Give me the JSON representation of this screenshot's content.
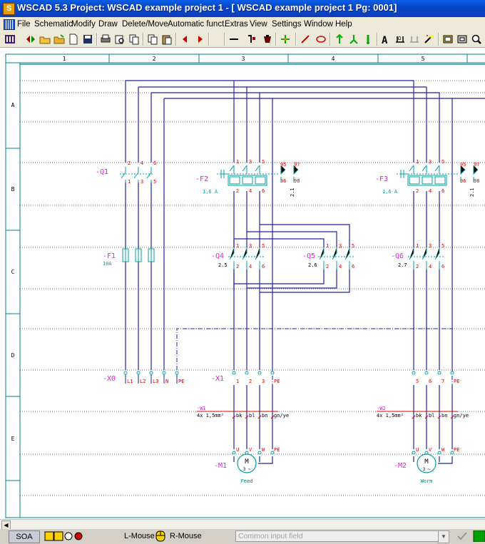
{
  "window": {
    "title": "WSCAD 5.3   Project: WSCAD example project 1 - [ WSCAD example project 1  Pg: 0001]",
    "app_icon": "S"
  },
  "menu": [
    "File",
    "Schematic",
    "Modify",
    "Draw",
    "Delete/Move",
    "Automatic funct.",
    "Extras",
    "View",
    "Settings",
    "Window",
    "Help"
  ],
  "sheet": {
    "columns": [
      "1",
      "2",
      "3",
      "4",
      "5"
    ],
    "rows": [
      "A",
      "B",
      "C",
      "D",
      "E"
    ]
  },
  "schematic": {
    "q1": {
      "ref": "-Q1",
      "pins_top": [
        "2",
        "4",
        "6"
      ],
      "pins_bottom": [
        "1",
        "3",
        "5"
      ]
    },
    "f1": {
      "ref": "-F1",
      "rating": "10A"
    },
    "x0": {
      "ref": "-X0",
      "terminals": [
        "L1",
        "L2",
        "L3",
        "N",
        "PE"
      ]
    },
    "f2": {
      "ref": "-F2",
      "rating": "1,6 A",
      "pins_top": [
        "1",
        "3",
        "5"
      ],
      "pins_bottom": [
        "2",
        "4",
        "6"
      ],
      "aux_top": [
        "95",
        "97"
      ],
      "aux_bottom": [
        "96",
        "98"
      ],
      "xref": "2.1"
    },
    "f3": {
      "ref": "-F3",
      "rating": "1,6 A",
      "pins_top": [
        "1",
        "3",
        "5"
      ],
      "pins_bottom": [
        "2",
        "4",
        "6"
      ],
      "aux_top": [
        "95",
        "97"
      ],
      "aux_bottom": [
        "96",
        "98"
      ],
      "xref": "2.1"
    },
    "q4": {
      "ref": "-Q4",
      "xref": "2.5",
      "pins_top": [
        "1",
        "3",
        "5"
      ],
      "pins_bottom": [
        "2",
        "4",
        "6"
      ]
    },
    "q5": {
      "ref": "-Q5",
      "xref": "2.6",
      "pins_top": [
        "1",
        "3",
        "5"
      ],
      "pins_bottom": [
        "2",
        "4",
        "6"
      ]
    },
    "q6": {
      "ref": "-Q6",
      "xref": "2.7",
      "pins_top": [
        "1",
        "3",
        "5"
      ],
      "pins_bottom": [
        "2",
        "4",
        "6"
      ]
    },
    "x1": {
      "ref": "-X1",
      "terminals": [
        "1",
        "2",
        "3",
        "PE"
      ]
    },
    "x1b": {
      "terminals": [
        "5",
        "6",
        "7",
        "PE"
      ]
    },
    "w1": {
      "ref": "-W1",
      "type": "4x 1,5mm²",
      "cores": [
        "bk",
        "bl",
        "bn",
        "gn/ye"
      ]
    },
    "w2": {
      "ref": "-W2",
      "type": "4x 1,5mm²",
      "cores": [
        "bk",
        "bl",
        "bn",
        "gn/ye"
      ]
    },
    "m1": {
      "ref": "-M1",
      "symbol": "M",
      "phase": "3 ~",
      "terminals": [
        "U",
        "V",
        "W",
        "PE"
      ],
      "label": "Feed"
    },
    "m2": {
      "ref": "-M2",
      "symbol": "M",
      "phase": "3 ~",
      "terminals": [
        "U",
        "V",
        "W",
        "PE"
      ],
      "label": "Worm"
    }
  },
  "status": {
    "mode": "SOA",
    "lmouse": "L-Mouse",
    "rmouse": "R-Mouse",
    "input_placeholder": "Common input field"
  },
  "colors": {
    "wire": "#2222aa",
    "ref": "#e020e0",
    "label": "#e00000",
    "symbol": "#00a0a0",
    "frame": "#008080"
  }
}
